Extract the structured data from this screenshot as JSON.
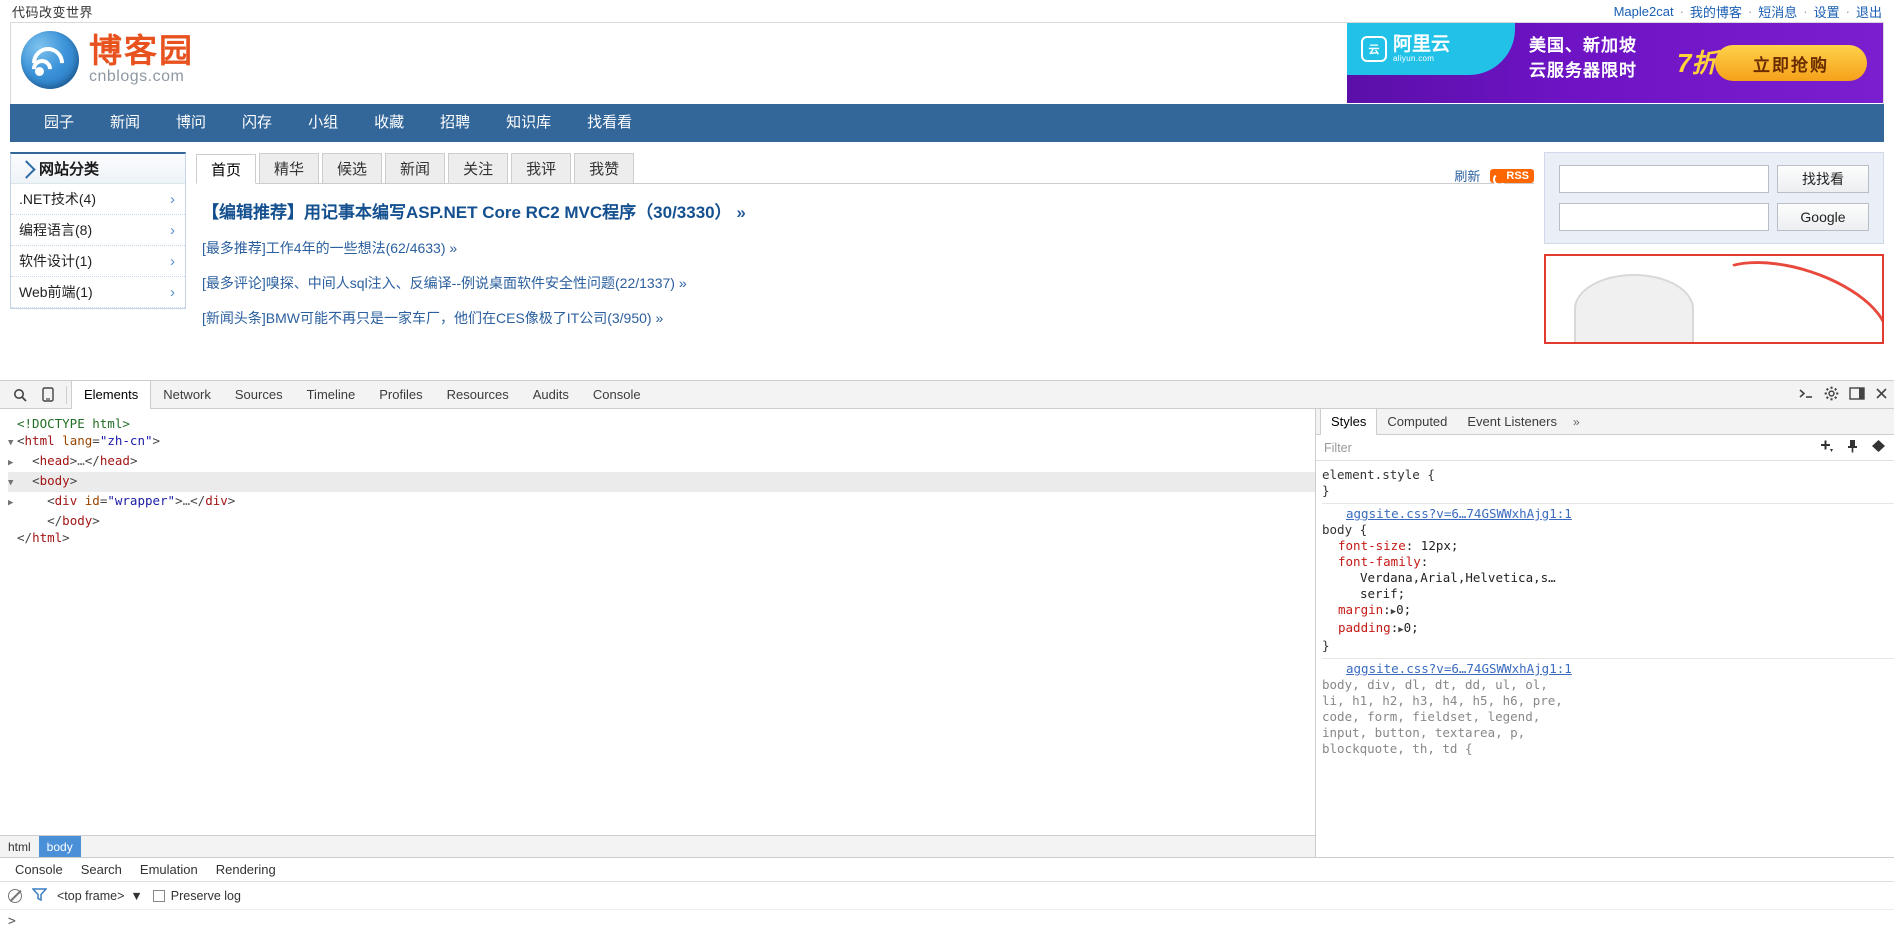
{
  "topbar": {
    "slogan": "代码改变世界",
    "user": "Maple2cat",
    "links": [
      "我的博客",
      "短消息",
      "设置",
      "退出"
    ],
    "sep": "·"
  },
  "header": {
    "logo_cn": "博客园",
    "logo_en": "cnblogs.com"
  },
  "ad": {
    "brand_name": "阿里云",
    "brand_sub": "aliyun.com",
    "badge": "云",
    "line1": "美国、新加坡",
    "line2": "云服务器限时",
    "discount": "7折抢购",
    "button": "立即抢购"
  },
  "nav": [
    "园子",
    "新闻",
    "博问",
    "闪存",
    "小组",
    "收藏",
    "招聘",
    "知识库",
    "找看看"
  ],
  "sidebar": {
    "title": "网站分类",
    "items": [
      {
        "label": ".NET技术(4)",
        "chevron": "›"
      },
      {
        "label": "编程语言(8)",
        "chevron": "›"
      },
      {
        "label": "软件设计(1)",
        "chevron": "›"
      },
      {
        "label": "Web前端(1)",
        "chevron": "›"
      }
    ]
  },
  "main": {
    "tabs": [
      {
        "label": "首页",
        "active": true
      },
      {
        "label": "精华",
        "active": false
      },
      {
        "label": "候选",
        "active": false
      },
      {
        "label": "新闻",
        "active": false
      },
      {
        "label": "关注",
        "active": false
      },
      {
        "label": "我评",
        "active": false
      },
      {
        "label": "我赞",
        "active": false
      }
    ],
    "refresh_label": "刷新",
    "rss_label": "RSS",
    "articles": [
      {
        "text": "【编辑推荐】用记事本编写ASP.NET Core RC2 MVC程序（30/3330）",
        "arrows": "»",
        "featured": true
      },
      {
        "text": "[最多推荐]工作4年的一些想法(62/4633)",
        "arrows": "»",
        "featured": false
      },
      {
        "text": "[最多评论]嗅探、中间人sql注入、反编译--例说桌面软件安全性问题(22/1337)",
        "arrows": "»",
        "featured": false
      },
      {
        "text": "[新闻头条]BMW可能不再只是一家车厂，他们在CES像极了IT公司(3/950)",
        "arrows": "»",
        "featured": false
      }
    ]
  },
  "search": {
    "site_value": "",
    "site_placeholder": "",
    "site_button": "找找看",
    "google_value": "",
    "google_placeholder": "",
    "google_button": "Google"
  },
  "devtools": {
    "tabs": [
      {
        "label": "Elements",
        "active": true
      },
      {
        "label": "Network",
        "active": false
      },
      {
        "label": "Sources",
        "active": false
      },
      {
        "label": "Timeline",
        "active": false
      },
      {
        "label": "Profiles",
        "active": false
      },
      {
        "label": "Resources",
        "active": false
      },
      {
        "label": "Audits",
        "active": false
      },
      {
        "label": "Console",
        "active": false
      }
    ],
    "inspect_icon": "search-icon",
    "device_icon": "device-toggle-icon",
    "right_icons": [
      "console-drawer-icon",
      "settings-gear-icon",
      "dock-position-icon",
      "close-icon"
    ],
    "dom": [
      {
        "indent": 0,
        "tri": "",
        "html": "<span class=\"comment\">&lt;!DOCTYPE html&gt;</span>",
        "selected": false
      },
      {
        "indent": 0,
        "tri": "▼",
        "html": "<span class=\"punct\">&lt;</span><span class=\"tag\">html</span> <span class=\"attr\">lang</span><span class=\"punct\">=</span><span class=\"val\">\"zh-cn\"</span><span class=\"punct\">&gt;</span>",
        "selected": false
      },
      {
        "indent": 1,
        "tri": "▶",
        "html": "<span class=\"punct\">&lt;</span><span class=\"tag\">head</span><span class=\"punct\">&gt;</span><span class=\"ellip\">…</span><span class=\"punct\">&lt;/</span><span class=\"tag\">head</span><span class=\"punct\">&gt;</span>",
        "selected": false
      },
      {
        "indent": 1,
        "tri": "▼",
        "html": "<span class=\"punct\">&lt;</span><span class=\"tag\">body</span><span class=\"punct\">&gt;</span>",
        "selected": true
      },
      {
        "indent": 2,
        "tri": "▶",
        "html": "<span class=\"punct\">&lt;</span><span class=\"tag\">div</span> <span class=\"attr\">id</span><span class=\"punct\">=</span><span class=\"val\">\"wrapper\"</span><span class=\"punct\">&gt;</span><span class=\"ellip\">…</span><span class=\"punct\">&lt;/</span><span class=\"tag\">div</span><span class=\"punct\">&gt;</span>",
        "selected": false
      },
      {
        "indent": 2,
        "tri": "",
        "html": "<span class=\"punct\">&lt;/</span><span class=\"tag\">body</span><span class=\"punct\">&gt;</span>",
        "selected": false
      },
      {
        "indent": 0,
        "tri": "",
        "html": "<span class=\"punct\">&lt;/</span><span class=\"tag\">html</span><span class=\"punct\">&gt;</span>",
        "selected": false
      }
    ],
    "breadcrumb": [
      {
        "label": "html",
        "active": false
      },
      {
        "label": "body",
        "active": true
      }
    ],
    "styles": {
      "tabs": [
        {
          "label": "Styles",
          "active": true
        },
        {
          "label": "Computed",
          "active": false
        },
        {
          "label": "Event Listeners",
          "active": false
        }
      ],
      "more": "»",
      "filter_placeholder": "Filter",
      "rules": [
        {
          "source": "",
          "selector": "element.style {",
          "declarations": [],
          "close": "}"
        },
        {
          "source": "aggsite.css?v=6…74GSWWxhAjg1:1",
          "selector": "body {",
          "declarations": [
            {
              "prop": "font-size",
              "value": "12px;"
            },
            {
              "prop": "font-family",
              "value": ""
            },
            {
              "prop": "",
              "value": "Verdana,Arial,Helvetica,s…"
            },
            {
              "prop": "",
              "value": "serif;"
            },
            {
              "prop": "margin",
              "value": "0;",
              "disclosure": true
            },
            {
              "prop": "padding",
              "value": "0;",
              "disclosure": true
            }
          ],
          "close": "}"
        },
        {
          "source": "aggsite.css?v=6…74GSWWxhAjg1:1",
          "selector": "body, div, dl, dt, dd, ul, ol,\nli, h1, h2, h3, h4, h5, h6, pre,\ncode, form, fieldset, legend,\ninput, button, textarea, p,\nblockquote, th, td {",
          "declarations": [],
          "close": ""
        }
      ]
    },
    "console": {
      "tabs": [
        {
          "label": "Console",
          "active": true
        },
        {
          "label": "Search",
          "active": false
        },
        {
          "label": "Emulation",
          "active": false
        },
        {
          "label": "Rendering",
          "active": false
        }
      ],
      "clear_icon": "clear-console-icon",
      "filter_icon": "filter-icon",
      "frame": "<top frame>",
      "frame_caret": "▼",
      "preserve_log": "Preserve log",
      "prompt": ">"
    }
  }
}
